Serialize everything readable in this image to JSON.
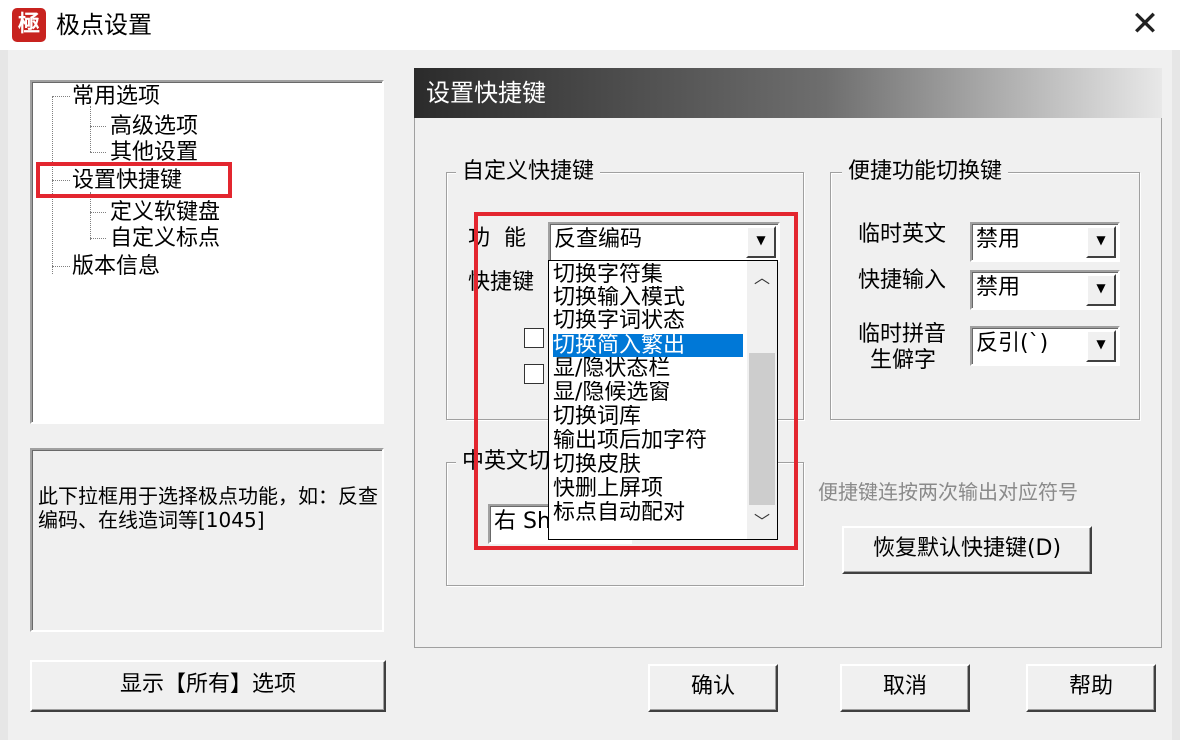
{
  "window": {
    "title": "极点设置",
    "app_icon_glyph": "極",
    "close_glyph": "✕"
  },
  "tree": {
    "items": [
      {
        "label": "常用选项",
        "level": 0
      },
      {
        "label": "高级选项",
        "level": 1
      },
      {
        "label": "其他设置",
        "level": 1
      },
      {
        "label": "设置快捷键",
        "level": 0,
        "selected": true
      },
      {
        "label": "定义软键盘",
        "level": 1
      },
      {
        "label": "自定义标点",
        "level": 1
      },
      {
        "label": "版本信息",
        "level": 0
      }
    ]
  },
  "description": "此下拉框用于选择极点功能，如：反查编码、在线造词等[1045]",
  "show_all_button": "显示【所有】选项",
  "panel": {
    "header": "设置快捷键",
    "custom_group": {
      "title": "自定义快捷键",
      "function_label": "功  能",
      "function_value": "反查编码",
      "shortcut_label": "快捷键"
    },
    "cn_en_group": {
      "title_visible": "中英文切",
      "value_visible": "右 Sh"
    },
    "quick_group": {
      "title": "便捷功能切换键",
      "rows": [
        {
          "label": "临时英文",
          "value": "禁用"
        },
        {
          "label": "快捷输入",
          "value": "禁用"
        },
        {
          "label_line1": "临时拼音",
          "label_line2": "生僻字",
          "value": "反引(`)"
        }
      ]
    },
    "hint": "便捷键连按两次输出对应符号",
    "restore_button": "恢复默认快捷键(D)"
  },
  "dropdown": {
    "items": [
      "切换字符集",
      "切换输入模式",
      "切换字词状态",
      "切换简入繁出",
      "显/隐状态栏",
      "显/隐候选窗",
      "切换词库",
      "输出项后加字符",
      "切换皮肤",
      "快删上屏项",
      "标点自动配对"
    ],
    "selected_index": 3
  },
  "buttons": {
    "ok": "确认",
    "cancel": "取消",
    "help": "帮助"
  },
  "colors": {
    "highlight": "#e3262f",
    "selection": "#0078d7",
    "app_icon": "#c8231f"
  }
}
